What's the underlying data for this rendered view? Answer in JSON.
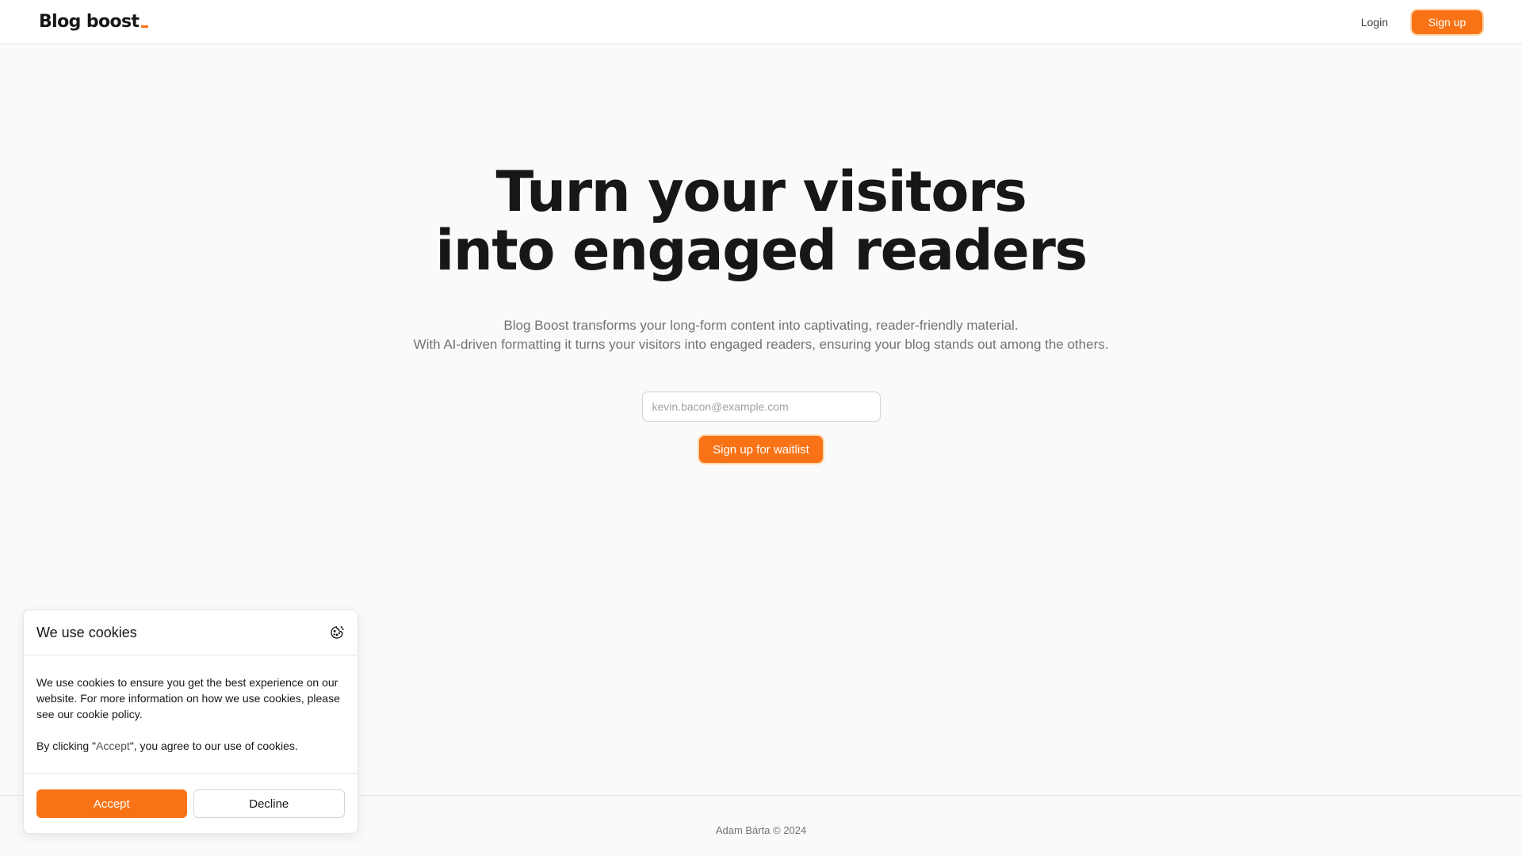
{
  "header": {
    "logo": "Blog boost",
    "login_label": "Login",
    "signup_label": "Sign up"
  },
  "hero": {
    "title_line1": "Turn your visitors",
    "title_line2": "into engaged readers",
    "subtitle_line1": "Blog Boost transforms your long-form content into captivating, reader-friendly material.",
    "subtitle_line2": "With AI-driven formatting it turns your visitors into engaged readers, ensuring your blog stands out among the others.",
    "email_placeholder": "kevin.bacon@example.com",
    "waitlist_label": "Sign up for waitlist"
  },
  "cookie": {
    "title": "We use cookies",
    "icon": "cookie-icon",
    "body1": "We use cookies to ensure you get the best experience on our website. For more information on how we use cookies, please see our cookie policy.",
    "body2_prefix": "By clicking \"",
    "body2_accent": "Accept",
    "body2_suffix": "\", you agree to our use of cookies.",
    "accept_label": "Accept",
    "decline_label": "Decline"
  },
  "footer": {
    "text": "Adam Bárta © 2024"
  },
  "colors": {
    "accent": "#f97316",
    "accent_ring": "#fed7aa",
    "background": "#fafafa",
    "text": "#171717",
    "muted": "#737373"
  }
}
